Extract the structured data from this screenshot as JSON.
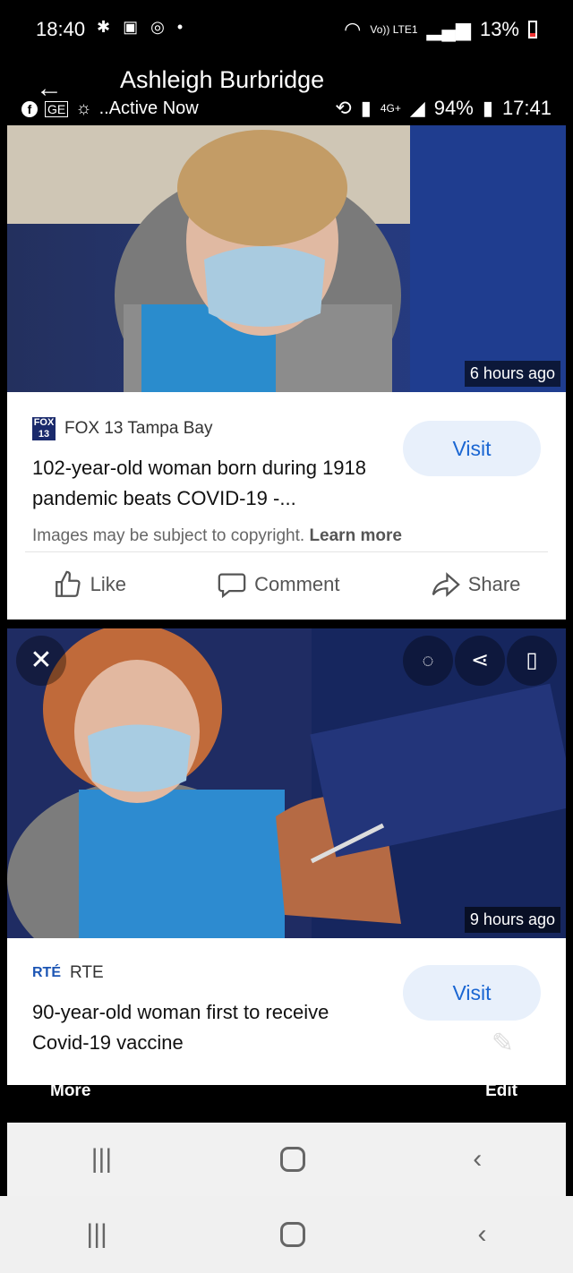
{
  "outer_status": {
    "time": "18:40",
    "left_icons": [
      "bug-icon",
      "image-icon",
      "alarm-icon",
      "dot-icon"
    ],
    "signal_label": "Vo)) LTE1",
    "battery": "13%"
  },
  "inner_header": {
    "contact_name": "Ashleigh Burbridge",
    "activity": "..Active Now",
    "inner_battery": "94%",
    "inner_time": "17:41",
    "network": "4G+"
  },
  "posts": [
    {
      "time_ago": "6 hours ago",
      "source": "FOX 13 Tampa Bay",
      "source_logo": "FOX 13",
      "headline": "102-year-old woman born during 1918 pandemic beats COVID-19 -...",
      "copyright": "Images may be subject to copyright.",
      "learn_more": "Learn more",
      "visit_label": "Visit"
    },
    {
      "time_ago": "9 hours ago",
      "source": "RTE",
      "source_logo": "RTÉ",
      "headline": "90-year-old woman first to receive Covid-19 vaccine",
      "visit_label": "Visit"
    }
  ],
  "actions": {
    "like": "Like",
    "comment": "Comment",
    "share": "Share"
  },
  "bottom_bar": {
    "more": "More",
    "edit": "Edit"
  },
  "colors": {
    "visit_bg": "#e8f0fb",
    "visit_text": "#1a66d2"
  }
}
